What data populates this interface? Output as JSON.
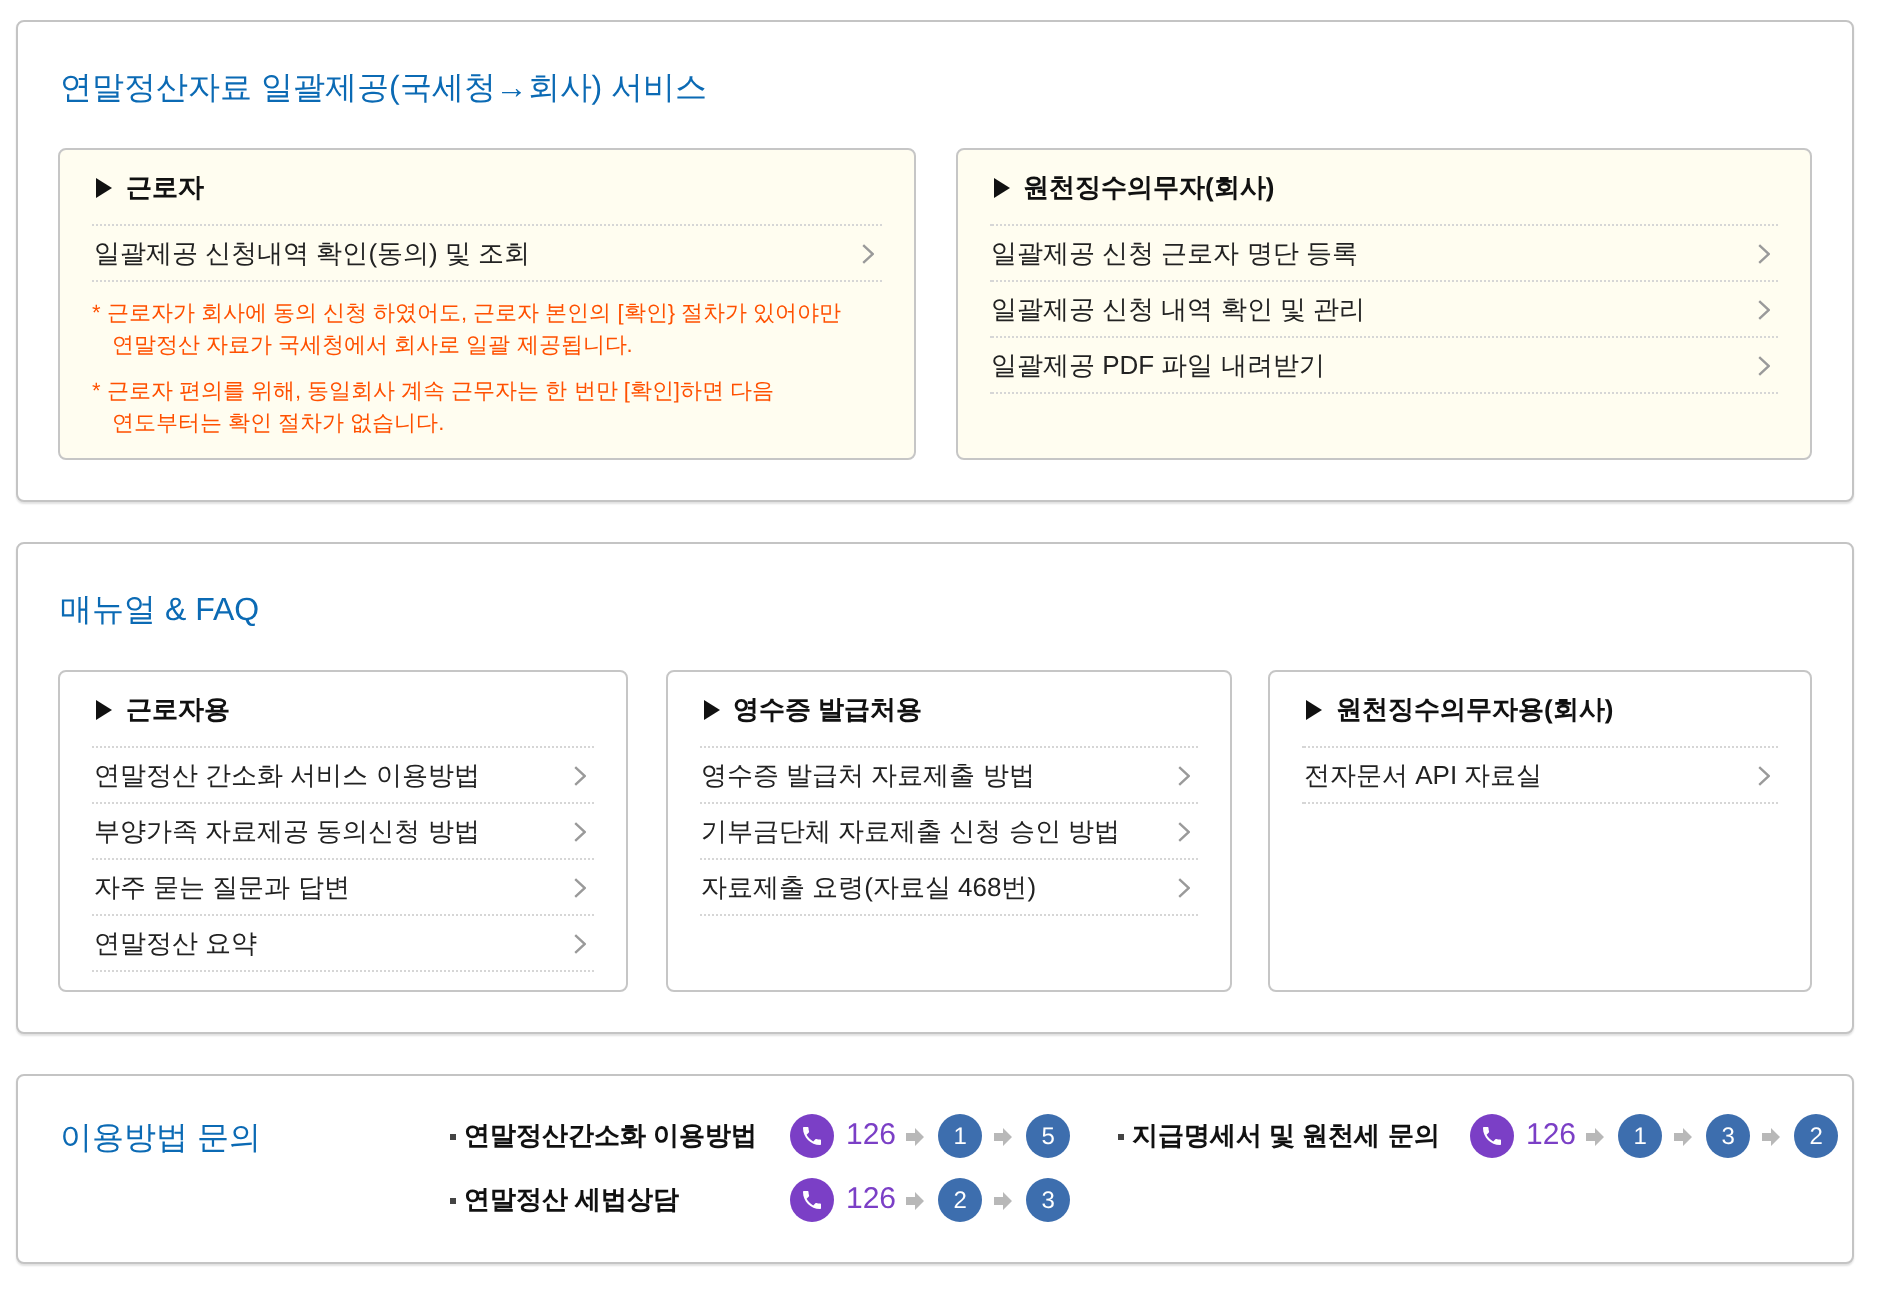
{
  "services": {
    "title": "연말정산자료 일괄제공(국세청→회사) 서비스",
    "panels": [
      {
        "heading": "근로자",
        "links": [
          "일괄제공 신청내역 확인(동의) 및 조회"
        ],
        "notes": [
          "* 근로자가 회사에 동의 신청 하였어도, 근로자 본인의 [확인} 절차가 있어야만 연말정산 자료가 국세청에서 회사로 일괄 제공됩니다.",
          "* 근로자 편의를 위해, 동일회사 계속 근무자는 한 번만 [확인]하면 다음 연도부터는 확인 절차가 없습니다."
        ]
      },
      {
        "heading": "원천징수의무자(회사)",
        "links": [
          "일괄제공 신청 근로자 명단 등록",
          "일괄제공 신청 내역 확인 및 관리",
          "일괄제공 PDF 파일 내려받기"
        ]
      }
    ]
  },
  "manual": {
    "title": "매뉴얼 & FAQ",
    "panels": [
      {
        "heading": "근로자용",
        "links": [
          "연말정산 간소화 서비스 이용방법",
          "부양가족 자료제공 동의신청 방법",
          "자주 묻는 질문과 답변",
          "연말정산 요약"
        ]
      },
      {
        "heading": "영수증 발급처용",
        "links": [
          "영수증 발급처 자료제출 방법",
          "기부금단체 자료제출 신청 승인 방법",
          "자료제출 요령(자료실 468번)"
        ]
      },
      {
        "heading": "원천징수의무자용(회사)",
        "links": [
          "전자문서 API 자료실"
        ]
      }
    ]
  },
  "inquiry": {
    "title": "이용방법 문의",
    "items": [
      {
        "label": "연말정산간소화 이용방법",
        "phone": "126",
        "steps": [
          "1",
          "5"
        ]
      },
      {
        "label": "지급명세서 및 원천세 문의",
        "phone": "126",
        "steps": [
          "1",
          "3",
          "2"
        ]
      },
      {
        "label": "연말정산 세법상담",
        "phone": "126",
        "steps": [
          "2",
          "3"
        ]
      }
    ]
  }
}
